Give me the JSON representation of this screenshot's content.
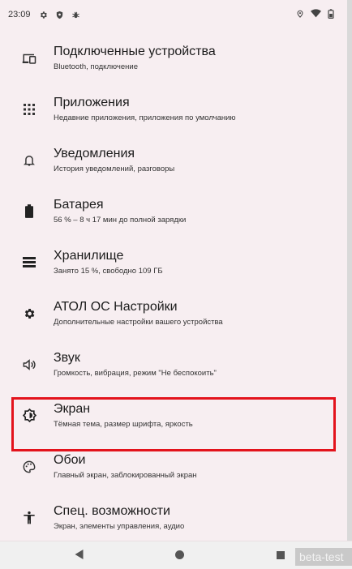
{
  "status_bar": {
    "time": "23:09",
    "left_icons": [
      "settings-gear-icon",
      "shield-icon",
      "bug-icon"
    ],
    "right_icons": [
      "location-icon",
      "wifi-icon",
      "battery-icon"
    ]
  },
  "settings": {
    "items": [
      {
        "icon": "connected-devices-icon",
        "title": "Подключенные устройства",
        "subtitle": "Bluetooth, подключение"
      },
      {
        "icon": "apps-grid-icon",
        "title": "Приложения",
        "subtitle": "Недавние приложения, приложения по умолчанию"
      },
      {
        "icon": "bell-icon",
        "title": "Уведомления",
        "subtitle": "История уведомлений, разговоры"
      },
      {
        "icon": "battery-icon",
        "title": "Батарея",
        "subtitle": "56 % – 8 ч 17 мин до полной зарядки"
      },
      {
        "icon": "storage-icon",
        "title": "Хранилище",
        "subtitle": "Занято 15 %, свободно 109 ГБ"
      },
      {
        "icon": "gear-icon",
        "title": "АТОЛ ОС Настройки",
        "subtitle": "Дополнительные настройки вашего устройства"
      },
      {
        "icon": "volume-icon",
        "title": "Звук",
        "subtitle": "Громкость, вибрация, режим \"Не беспокоить\""
      },
      {
        "icon": "display-brightness-icon",
        "title": "Экран",
        "subtitle": "Тёмная тема, размер шрифта, яркость"
      },
      {
        "icon": "palette-icon",
        "title": "Обои",
        "subtitle": "Главный экран, заблокированный экран"
      },
      {
        "icon": "accessibility-icon",
        "title": "Спец. возможности",
        "subtitle": "Экран, элементы управления, аудио"
      }
    ]
  },
  "highlight_color": "#e3131c",
  "background_color": "#f7eef1",
  "watermark": "beta-test"
}
